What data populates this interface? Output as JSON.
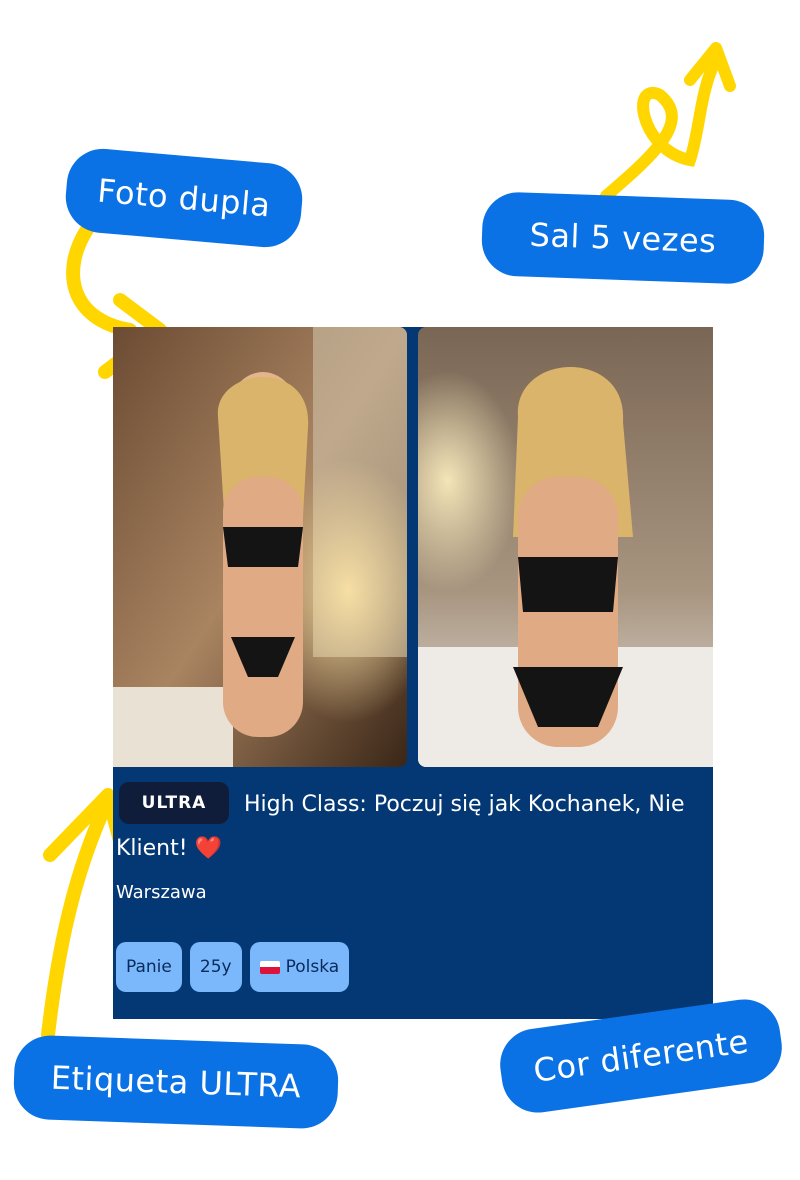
{
  "callouts": {
    "double_photo": "Foto dupla",
    "jumps": "Sal 5 vezes",
    "ultra_tag": "Etiqueta ULTRA",
    "different_color": "Cor diferente"
  },
  "listing": {
    "badge": "ULTRA",
    "title": "High Class: Poczuj się jak Kochanek, Nie Klient! ❤️",
    "city": "Warszawa",
    "tags": [
      "Panie",
      "25y",
      "Polska"
    ],
    "country_flag_icon": "poland-flag-icon"
  },
  "colors": {
    "callout_blue": "#0b72e6",
    "arrow_yellow": "#ffd600",
    "card_background": "#033874",
    "tag_background": "#7ab8fb",
    "badge_background": "#0f1d3a"
  }
}
